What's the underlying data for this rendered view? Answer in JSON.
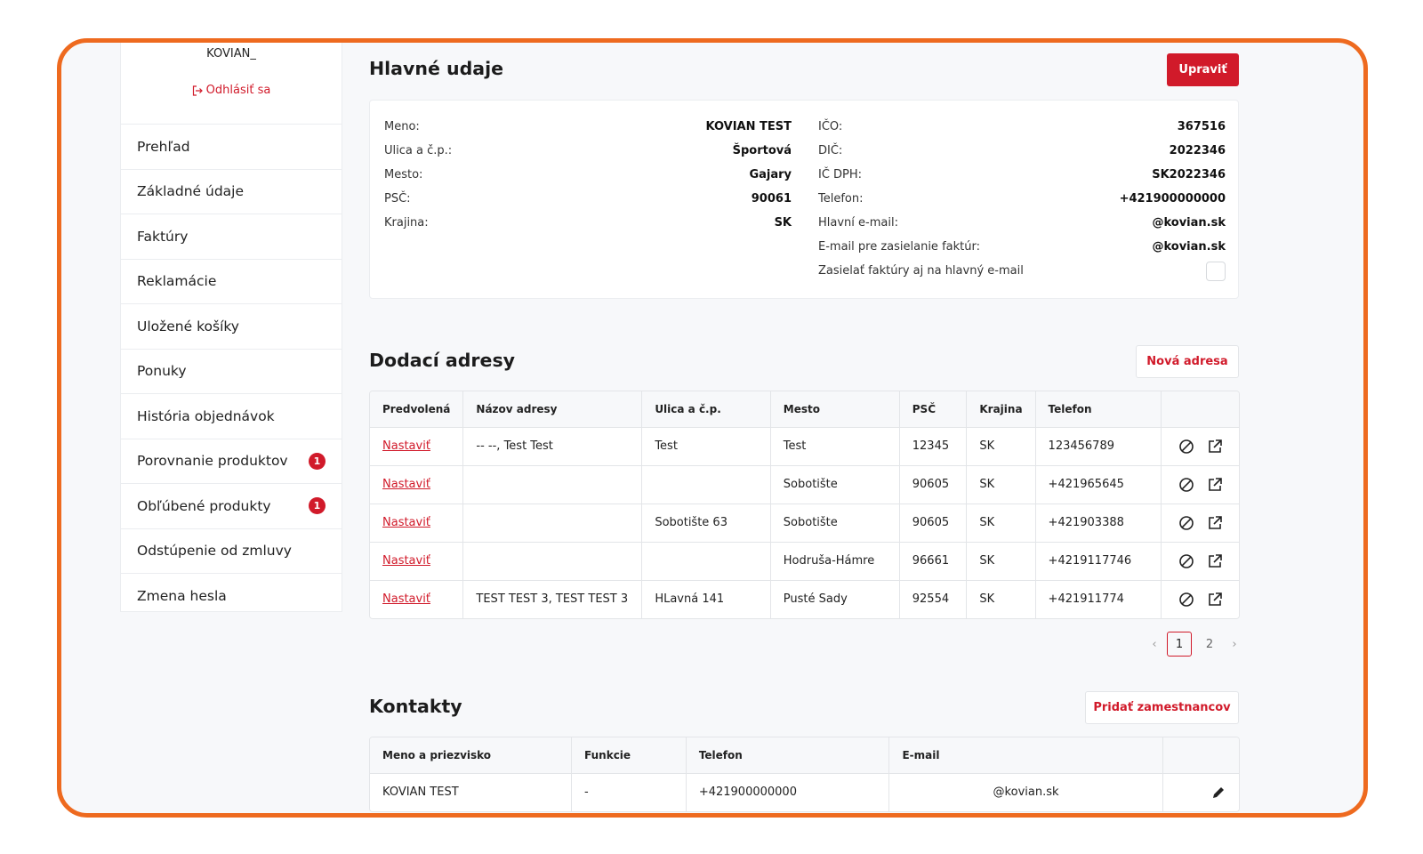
{
  "sidebar": {
    "username": "KOVIAN_",
    "logout": "Odhlásiť sa",
    "items": [
      {
        "label": "Prehľad",
        "badge": ""
      },
      {
        "label": "Základné údaje",
        "badge": ""
      },
      {
        "label": "Faktúry",
        "badge": ""
      },
      {
        "label": "Reklamácie",
        "badge": ""
      },
      {
        "label": "Uložené košíky",
        "badge": ""
      },
      {
        "label": "Ponuky",
        "badge": ""
      },
      {
        "label": "História objednávok",
        "badge": ""
      },
      {
        "label": "Porovnanie produktov",
        "badge": "1"
      },
      {
        "label": "Obľúbené produkty",
        "badge": "1"
      },
      {
        "label": "Odstúpenie od zmluvy",
        "badge": ""
      },
      {
        "label": "Zmena hesla",
        "badge": ""
      }
    ]
  },
  "main_info": {
    "title": "Hlavné udaje",
    "edit_button": "Upraviť",
    "left": [
      {
        "label": "Meno:",
        "value": "KOVIAN TEST"
      },
      {
        "label": "Ulica a č.p.:",
        "value": "Športová"
      },
      {
        "label": "Mesto:",
        "value": "Gajary"
      },
      {
        "label": "PSČ:",
        "value": "90061"
      },
      {
        "label": "Krajina:",
        "value": "SK"
      }
    ],
    "right": [
      {
        "label": "IČO:",
        "value": "367516"
      },
      {
        "label": "DIČ:",
        "value": "2022346"
      },
      {
        "label": "IČ DPH:",
        "value": "SK2022346"
      },
      {
        "label": "Telefon:",
        "value": "+421900000000"
      },
      {
        "label": "Hlavní e-mail:",
        "value": "@kovian.sk"
      },
      {
        "label": "E-mail pre zasielanie faktúr:",
        "value": "@kovian.sk"
      }
    ],
    "send_also_label": "Zasielať faktúry aj na hlavný e-mail"
  },
  "addresses": {
    "title": "Dodací adresy",
    "new_button": "Nová adresa",
    "columns": [
      "Predvolená",
      "Názov adresy",
      "Ulica a č.p.",
      "Mesto",
      "PSČ",
      "Krajina",
      "Telefon",
      ""
    ],
    "set_label": "Nastaviť",
    "rows": [
      {
        "name": "-- --, Test Test",
        "street": "Test",
        "city": "Test",
        "zip": "12345",
        "country": "SK",
        "phone": "123456789"
      },
      {
        "name": "",
        "street": "",
        "city": "Sobotište",
        "zip": "90605",
        "country": "SK",
        "phone": "+421965645"
      },
      {
        "name": "",
        "street": "Sobotište 63",
        "city": "Sobotište",
        "zip": "90605",
        "country": "SK",
        "phone": "+421903388"
      },
      {
        "name": "",
        "street": "",
        "city": "Hodruša-Hámre",
        "zip": "96661",
        "country": "SK",
        "phone": "+4219117746"
      },
      {
        "name": "TEST TEST 3, TEST TEST 3",
        "street": "HLavná 141",
        "city": "Pusté Sady",
        "zip": "92554",
        "country": "SK",
        "phone": "+421911774"
      }
    ],
    "pages": [
      "1",
      "2"
    ],
    "current_page": "1"
  },
  "contacts": {
    "title": "Kontakty",
    "add_button": "Pridať zamestnancov",
    "columns": [
      "Meno a priezvisko",
      "Funkcie",
      "Telefon",
      "E-mail",
      ""
    ],
    "rows": [
      {
        "name": "KOVIAN TEST",
        "function": "-",
        "phone": "+421900000000",
        "email": "@kovian.sk"
      }
    ]
  },
  "colors": {
    "accent": "#d11a2a",
    "frame": "#ee6a1f"
  }
}
